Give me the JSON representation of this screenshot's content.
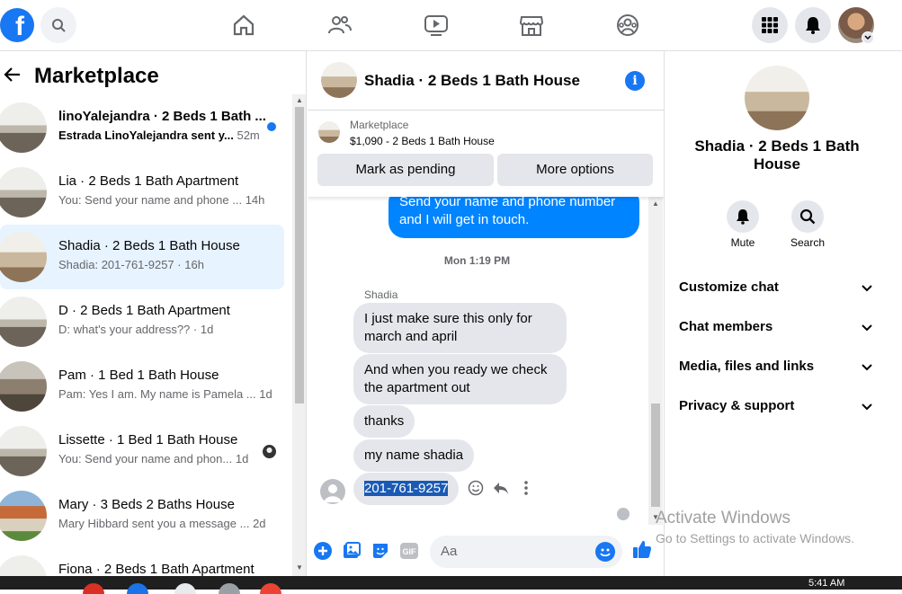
{
  "topbar": {
    "logo": "f",
    "icons": [
      "search-icon",
      "home-icon",
      "friends-icon",
      "watch-icon",
      "marketplace-icon",
      "groups-icon",
      "menu-grid-icon",
      "notifications-icon",
      "account-avatar"
    ]
  },
  "left": {
    "title": "Marketplace",
    "conversations": [
      {
        "title": "linoYalejandra · 2 Beds 1 Bath ...",
        "preview": "Estrada LinoYalejandra sent y...",
        "time": "52m",
        "unread": true
      },
      {
        "title": "Lia · 2 Beds 1 Bath Apartment",
        "preview": "You: Send your name and phone ...",
        "time": "14h"
      },
      {
        "title": "Shadia · 2 Beds 1 Bath House",
        "preview": "Shadia: 201-761-9257 ·",
        "time": "16h",
        "active": true
      },
      {
        "title": "D · 2 Beds 1 Bath Apartment",
        "preview": "D: what's your address?? ·",
        "time": "1d"
      },
      {
        "title": "Pam · 1 Bed 1 Bath House",
        "preview": "Pam: Yes I am. My name is Pamela ...",
        "time": "1d"
      },
      {
        "title": "Lissette · 1 Bed 1 Bath House",
        "preview": "You: Send your name and phon...",
        "time": "1d"
      },
      {
        "title": "Mary · 3 Beds 2 Baths House",
        "preview": "Mary Hibbard sent you a message ...",
        "time": "2d"
      },
      {
        "title": "Fiona · 2 Beds 1 Bath Apartment",
        "preview": "",
        "time": ""
      }
    ]
  },
  "chat": {
    "title": "Shadia · 2 Beds 1 Bath House",
    "listing": {
      "label": "Marketplace",
      "price_line": "$1,090 - 2 Beds 1 Bath House",
      "pending_button": "Mark as pending",
      "more_button": "More options"
    },
    "outgoing": "Send your name and phone number and I will get in touch.",
    "timestamp": "Mon 1:19 PM",
    "sender": "Shadia",
    "incoming": [
      "I just make sure this only for march and april",
      "And when you ready we check the apartment out",
      "thanks",
      "my name shadia",
      "201-761-9257"
    ],
    "composer_placeholder": "Aa"
  },
  "details": {
    "title": "Shadia · 2 Beds 1 Bath House",
    "mute_label": "Mute",
    "search_label": "Search",
    "menu": [
      "Customize chat",
      "Chat members",
      "Media, files and links",
      "Privacy & support"
    ]
  },
  "watermark": {
    "line1": "Activate Windows",
    "line2": "Go to Settings to activate Windows."
  },
  "taskbar": {
    "time": "5:41 AM"
  },
  "colors": {
    "brand": "#1877f2",
    "outgoing_bubble": "#0084ff",
    "incoming_bubble": "#e4e6eb",
    "active_conversation": "#e7f3ff"
  }
}
